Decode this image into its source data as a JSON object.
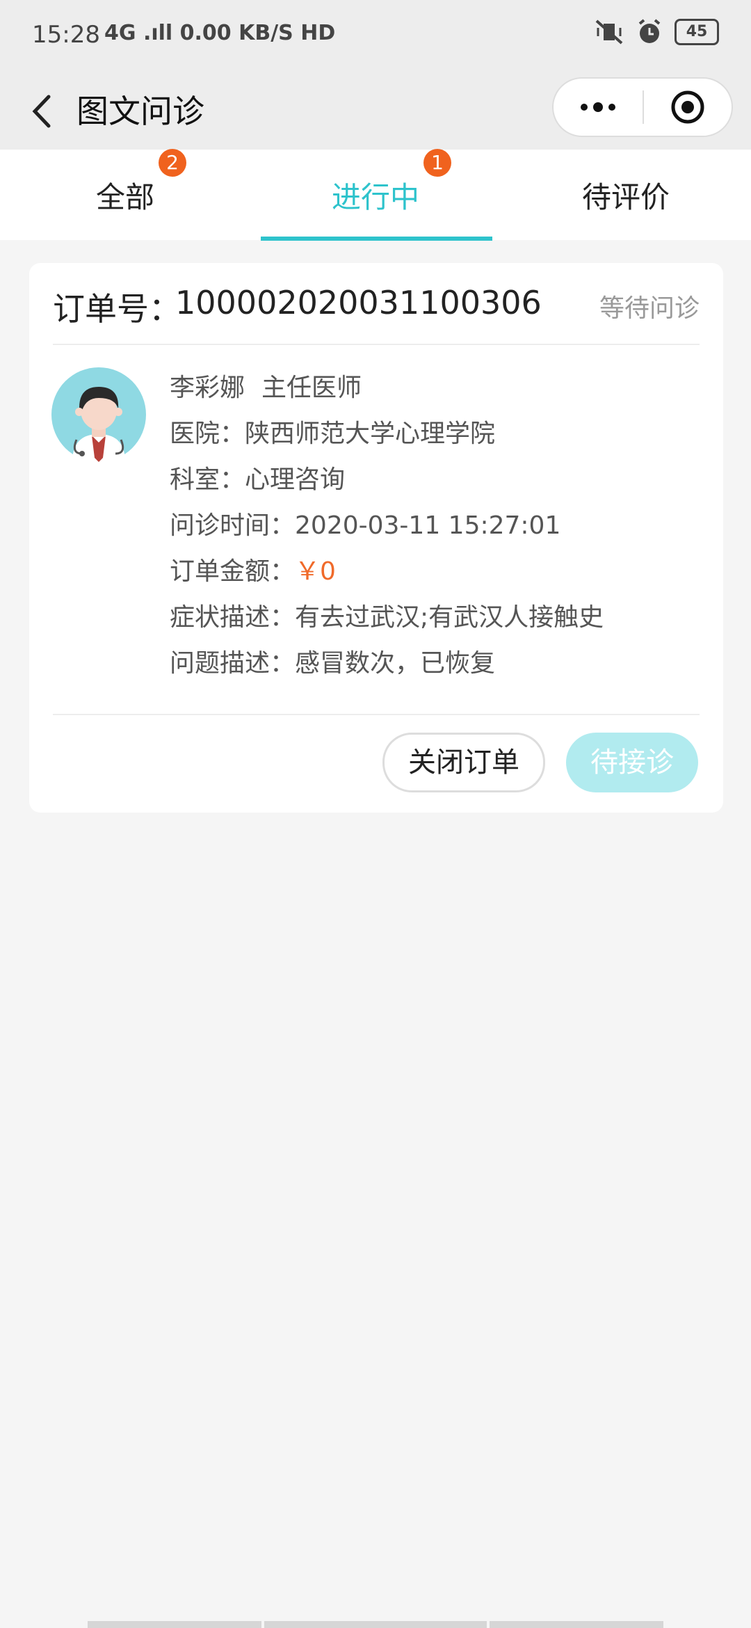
{
  "status_bar": {
    "time": "15:28",
    "network": "4G .ıll 0.00 KB/S HD",
    "battery": "45"
  },
  "nav": {
    "title": "图文问诊"
  },
  "tabs": [
    {
      "label": "全部",
      "badge": "2"
    },
    {
      "label": "进行中",
      "badge": "1"
    },
    {
      "label": "待评价",
      "badge": ""
    }
  ],
  "order": {
    "number_label": "订单号：",
    "number": "100002020031100306",
    "status": "等待问诊",
    "doctor_name": "李彩娜",
    "doctor_title": "主任医师",
    "hospital_label": "医院：",
    "hospital": "陕西师范大学心理学院",
    "department_label": "科室：",
    "department": "心理咨询",
    "time_label": "问诊时间：",
    "time": "2020-03-11 15:27:01",
    "amount_label": "订单金额：",
    "amount": "￥0",
    "symptom_label": "症状描述：",
    "symptom": "有去过武汉;有武汉人接触史",
    "problem_label": "问题描述：",
    "problem": "感冒数次，已恢复",
    "close_button": "关闭订单",
    "wait_button": "待接诊"
  },
  "colors": {
    "accent": "#2ec3cc",
    "badge": "#f0621e",
    "money": "#f06a2a",
    "wait_button": "#b1ebef"
  }
}
